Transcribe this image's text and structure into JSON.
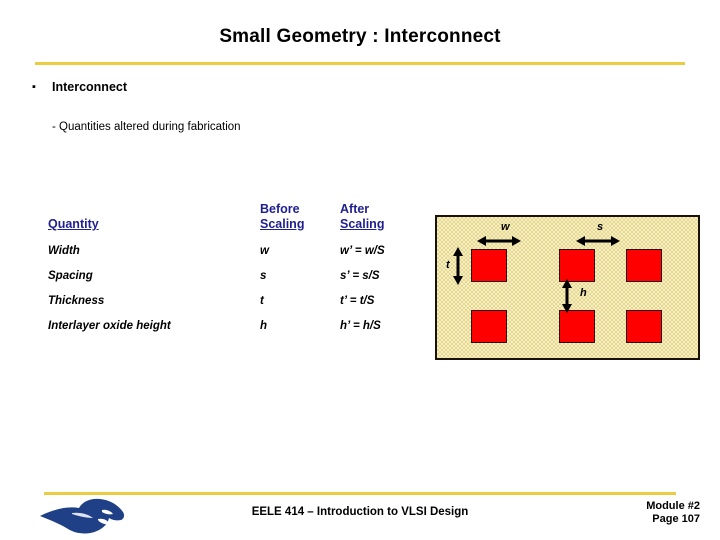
{
  "slide": {
    "title": "Small Geometry : Interconnect",
    "accent_color": "#eccc43",
    "header_text_color": "#1f1f8f"
  },
  "body": {
    "bullet_marker": "▪",
    "bullet": "Interconnect",
    "subbullet": "- Quantities altered during fabrication"
  },
  "table": {
    "headers": {
      "quantity": "Quantity",
      "before_line1": "Before",
      "before_line2": "Scaling",
      "after_line1": "After",
      "after_line2": "Scaling"
    },
    "rows": [
      {
        "quantity": "Width",
        "before": "w",
        "after": "w’ = w/S"
      },
      {
        "quantity": "Spacing",
        "before": "s",
        "after": "s’ = s/S"
      },
      {
        "quantity": "Thickness",
        "before": "t",
        "after": "t’  = t/S"
      },
      {
        "quantity": "Interlayer oxide height",
        "before": "h",
        "after": "h’ = h/S"
      }
    ]
  },
  "diagram": {
    "substrate_color": "#e8d98a",
    "wire_color": "#fe0000",
    "border_color": "#1a1208",
    "labels": {
      "width": "w",
      "spacing": "s",
      "thickness": "t",
      "oxide_height": "h"
    },
    "wires": [
      {
        "id": "r1c1"
      },
      {
        "id": "r1c2"
      },
      {
        "id": "r1c3"
      },
      {
        "id": "r2c1"
      },
      {
        "id": "r2c2"
      },
      {
        "id": "r2c3"
      }
    ]
  },
  "footer": {
    "course": "EELE 414 – Introduction to VLSI Design",
    "module": "Module #2",
    "page": "Page 107",
    "logo_color": "#1f3f87"
  }
}
